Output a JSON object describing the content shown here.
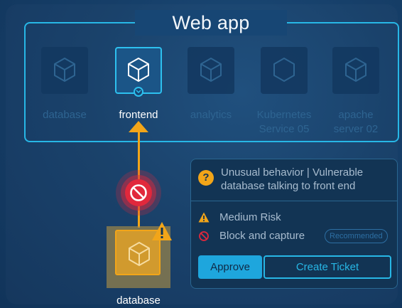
{
  "group": {
    "title": "Web app"
  },
  "nodes": [
    {
      "label": "database",
      "state": "inactive"
    },
    {
      "label": "frontend",
      "state": "selected"
    },
    {
      "label": "analytics",
      "state": "inactive"
    },
    {
      "label": "Kubernetes Service 05",
      "state": "inactive"
    },
    {
      "label": "apache server 02",
      "state": "inactive"
    }
  ],
  "source": {
    "label": "database",
    "status": "warning"
  },
  "connection": {
    "status": "blocked"
  },
  "alert": {
    "title": "Unusual behavior | Vulnerable database talking to front end",
    "risk": "Medium Risk",
    "action": "Block and capture",
    "badge": "Recommended",
    "approve_label": "Approve",
    "ticket_label": "Create Ticket"
  },
  "colors": {
    "accent": "#27b7e6",
    "warning": "#f2a519",
    "danger": "#e1283c",
    "background": "#163f69",
    "muted_text": "#2e6491"
  },
  "icons": {
    "node": "cube-icon",
    "blocked": "block-icon",
    "warning": "warning-icon",
    "question": "question-icon",
    "expand": "chevron-down-icon"
  }
}
